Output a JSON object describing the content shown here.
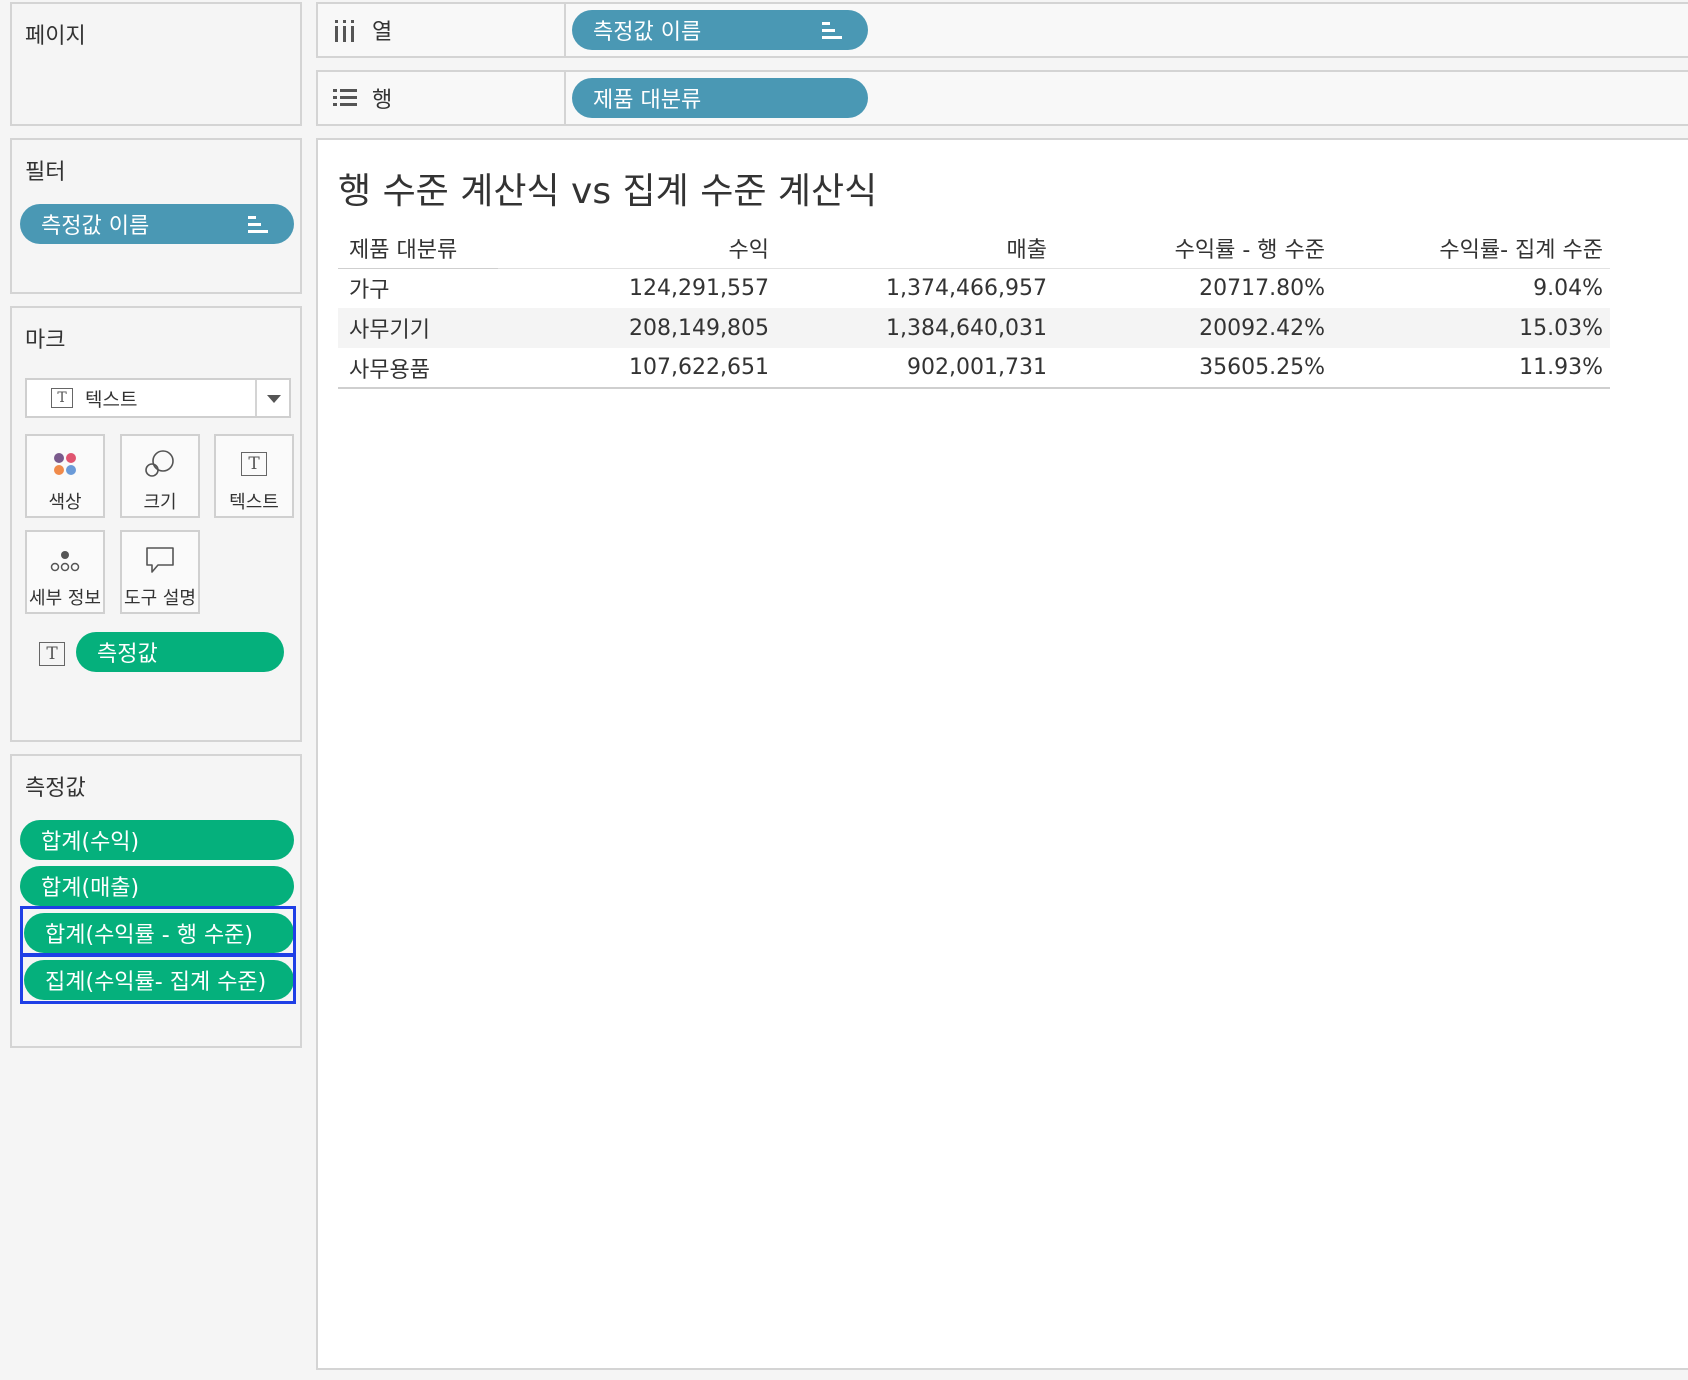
{
  "pages": {
    "title": "페이지"
  },
  "filters": {
    "title": "필터",
    "items": [
      {
        "label": "측정값 이름"
      }
    ]
  },
  "marks": {
    "title": "마크",
    "type_dropdown": {
      "selected": "텍스트"
    },
    "buttons": [
      {
        "label": "색상",
        "icon": "color-icon"
      },
      {
        "label": "크기",
        "icon": "size-icon"
      },
      {
        "label": "텍스트",
        "icon": "text-icon"
      },
      {
        "label": "세부 정보",
        "icon": "detail-icon"
      },
      {
        "label": "도구 설명",
        "icon": "tooltip-icon"
      }
    ],
    "field": {
      "label": "측정값",
      "icon": "text-icon"
    }
  },
  "measure_values": {
    "title": "측정값",
    "items": [
      {
        "label": "합계(수익)",
        "highlighted": false
      },
      {
        "label": "합계(매출)",
        "highlighted": false
      },
      {
        "label": "합계(수익률 - 행 수준)",
        "highlighted": true
      },
      {
        "label": "집계(수익률- 집계 수준)",
        "highlighted": true
      }
    ]
  },
  "shelves": {
    "columns": {
      "label": "열",
      "pill": "측정값 이름"
    },
    "rows": {
      "label": "행",
      "pill": "제품 대분류"
    }
  },
  "viz": {
    "title": "행 수준 계산식 vs 집계 수준 계산식",
    "headers": [
      "제품 대분류",
      "수익",
      "매출",
      "수익률 - 행 수준",
      "수익률- 집계 수준"
    ],
    "rows": [
      [
        "가구",
        "124,291,557",
        "1,374,466,957",
        "20717.80%",
        "9.04%"
      ],
      [
        "사무기기",
        "208,149,805",
        "1,384,640,031",
        "20092.42%",
        "15.03%"
      ],
      [
        "사무용품",
        "107,622,651",
        "902,001,731",
        "35605.25%",
        "11.93%"
      ]
    ]
  },
  "colors": {
    "dimension_pill": "#4a98b4",
    "measure_pill": "#05b07c",
    "highlight_border": "#1f3fe6"
  }
}
